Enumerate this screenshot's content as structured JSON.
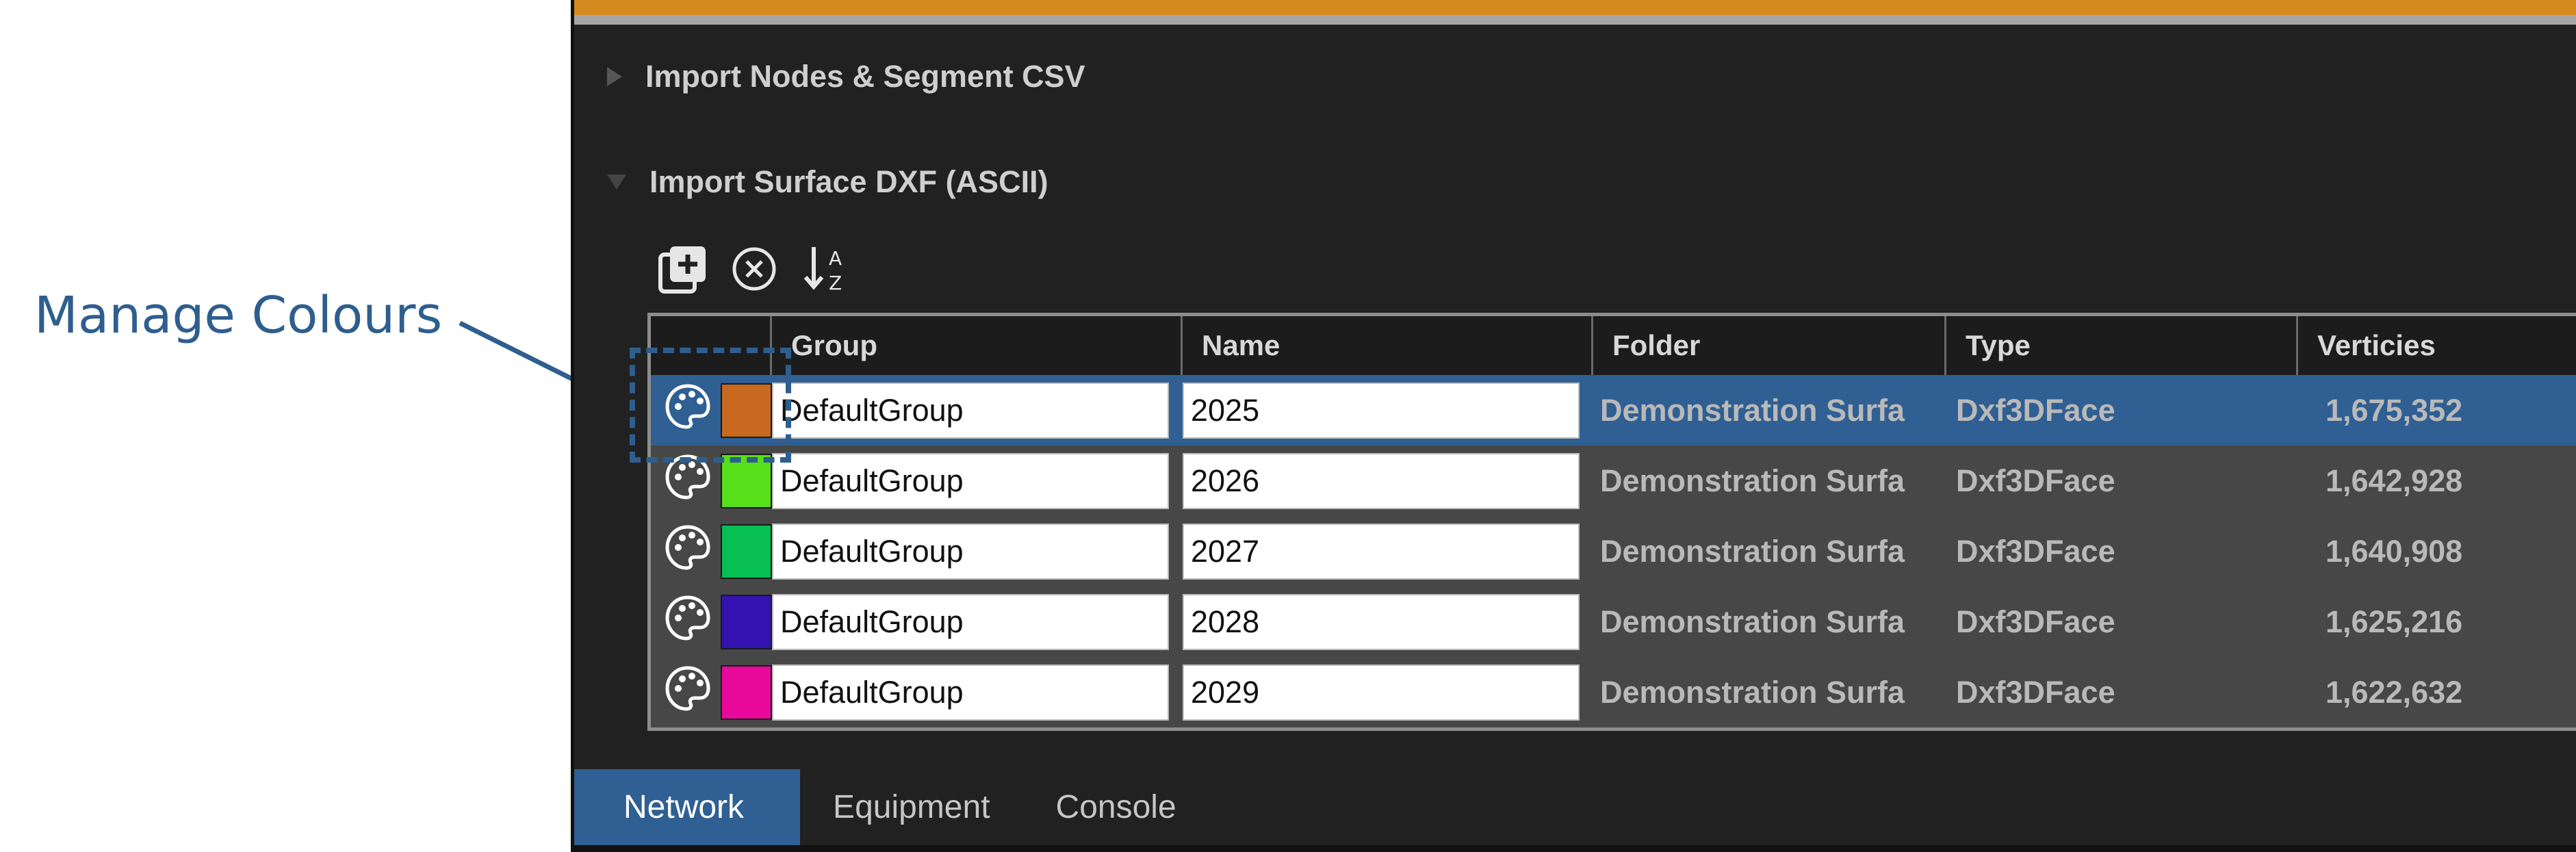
{
  "annotation": {
    "label": "Manage Colours",
    "color": "#2e5e8e"
  },
  "sections": [
    {
      "label": "Import Nodes & Segment CSV",
      "expanded": false
    },
    {
      "label": "Import Surface DXF (ASCII)",
      "expanded": true
    }
  ],
  "toolbar": [
    {
      "icon": "add-layer-icon"
    },
    {
      "icon": "remove-circle-icon"
    },
    {
      "icon": "sort-az-icon"
    }
  ],
  "table": {
    "headers": [
      "",
      "Group",
      "Name",
      "Folder",
      "Type",
      "Verticies"
    ],
    "rows": [
      {
        "color": "#c9691f",
        "group": "DefaultGroup",
        "name": "2025",
        "folder": "Demonstration Surfa",
        "type": "Dxf3DFace",
        "vertices": "1,675,352",
        "selected": true
      },
      {
        "color": "#57e01a",
        "group": "DefaultGroup",
        "name": "2026",
        "folder": "Demonstration Surfa",
        "type": "Dxf3DFace",
        "vertices": "1,642,928",
        "selected": false
      },
      {
        "color": "#08bf55",
        "group": "DefaultGroup",
        "name": "2027",
        "folder": "Demonstration Surfa",
        "type": "Dxf3DFace",
        "vertices": "1,640,908",
        "selected": false
      },
      {
        "color": "#3312b0",
        "group": "DefaultGroup",
        "name": "2028",
        "folder": "Demonstration Surfa",
        "type": "Dxf3DFace",
        "vertices": "1,625,216",
        "selected": false
      },
      {
        "color": "#e8089a",
        "group": "DefaultGroup",
        "name": "2029",
        "folder": "Demonstration Surfa",
        "type": "Dxf3DFace",
        "vertices": "1,622,632",
        "selected": false
      }
    ]
  },
  "tabs": [
    {
      "label": "Network",
      "active": true
    },
    {
      "label": "Equipment",
      "active": false
    },
    {
      "label": "Console",
      "active": false
    }
  ],
  "colors": {
    "accent": "#2f5f93",
    "top_accent": "#d48a1c"
  }
}
